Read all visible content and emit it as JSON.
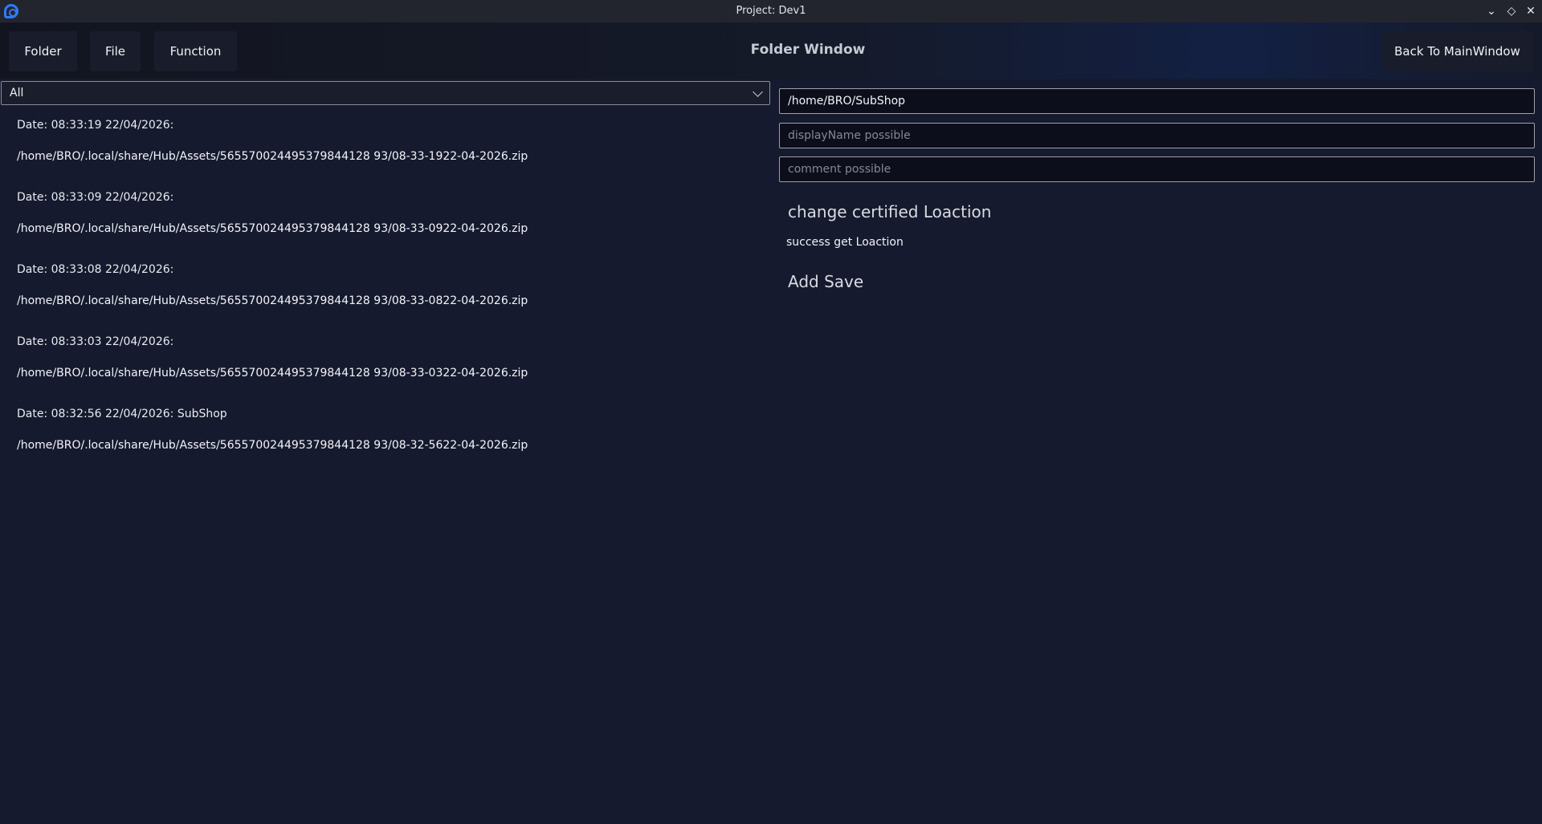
{
  "window": {
    "title": "Project: Dev1",
    "controls": [
      "minimize-icon",
      "maximize-icon",
      "close-icon"
    ]
  },
  "header": {
    "menu": {
      "folder": "Folder",
      "file": "File",
      "function": "Function"
    },
    "title": "Folder Window",
    "back_button": "Back To MainWindow"
  },
  "filter": {
    "selected": "All"
  },
  "entries": [
    {
      "date": "Date: 08:33:19 22/04/2026:",
      "path": "/home/BRO/.local/share/Hub/Assets/565570024495379844128 93/08-33-1922-04-2026.zip"
    },
    {
      "date": "Date: 08:33:09 22/04/2026:",
      "path": "/home/BRO/.local/share/Hub/Assets/565570024495379844128 93/08-33-0922-04-2026.zip"
    },
    {
      "date": "Date: 08:33:08 22/04/2026:",
      "path": "/home/BRO/.local/share/Hub/Assets/565570024495379844128 93/08-33-0822-04-2026.zip"
    },
    {
      "date": "Date: 08:33:03 22/04/2026:",
      "path": "/home/BRO/.local/share/Hub/Assets/565570024495379844128 93/08-33-0322-04-2026.zip"
    },
    {
      "date": "Date: 08:32:56 22/04/2026: SubShop",
      "path": "/home/BRO/.local/share/Hub/Assets/565570024495379844128 93/08-32-5622-04-2026.zip"
    }
  ],
  "form": {
    "path_value": "/home/BRO/SubShop",
    "display_name_placeholder": "displayName possible",
    "comment_placeholder": "comment possible",
    "change_location_label": "change certified Loaction",
    "status": "success get Loaction",
    "add_save_label": "Add Save"
  },
  "colors": {
    "background": "#161a2e",
    "titlebar": "#23252e",
    "accent": "#2f7bff"
  }
}
